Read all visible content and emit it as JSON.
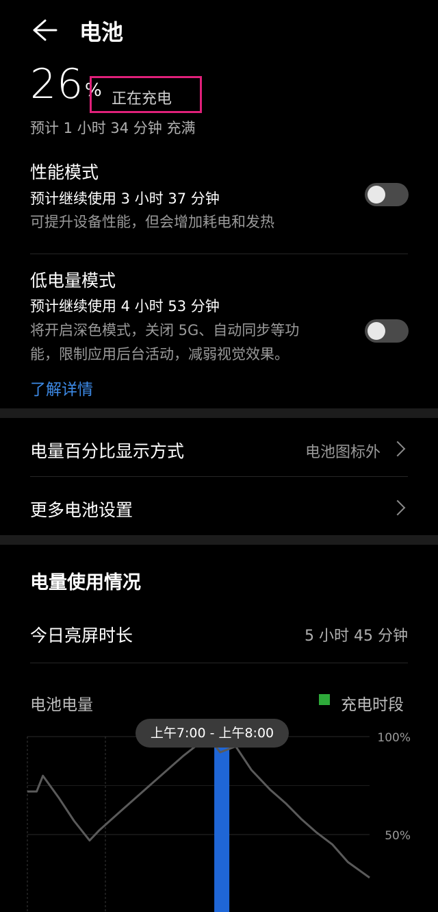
{
  "header": {
    "title": "电池",
    "back_icon": "arrow-left-icon"
  },
  "battery": {
    "level": "26",
    "unit": "%",
    "status": "正在充电",
    "estimate": "预计 1 小时 34 分钟 充满"
  },
  "performance_mode": {
    "title": "性能模式",
    "estimate": "预计继续使用 3 小时 37 分钟",
    "description": "可提升设备性能，但会增加耗电和发热",
    "enabled": false
  },
  "low_power_mode": {
    "title": "低电量模式",
    "estimate": "预计继续使用 4 小时 53 分钟",
    "description_line1": "将开启深色模式，关闭 5G、自动同步等功",
    "description_line2": "能，限制应用后台活动，减弱视觉效果。",
    "enabled": false,
    "learn_more": "了解详情"
  },
  "settings": {
    "percentage_display": {
      "label": "电量百分比显示方式",
      "value": "电池图标外"
    },
    "more_settings": {
      "label": "更多电池设置"
    }
  },
  "usage": {
    "section_title": "电量使用情况",
    "screen_time_label": "今日亮屏时长",
    "screen_time_value": "5 小时 45 分钟"
  },
  "chart_data": {
    "type": "line",
    "title": "电池电量",
    "legend": [
      "充电时段"
    ],
    "legend_color": "#2eaa3a",
    "tooltip": "上午7:00 - 上午8:00",
    "y_ticks": [
      "100%",
      "50%"
    ],
    "ylim": [
      0,
      100
    ],
    "line_color": "#5a5a5a",
    "charge_color": "#1f66d6",
    "series": [
      {
        "values": [
          [
            0,
            72
          ],
          [
            0.3,
            72
          ],
          [
            0.5,
            80
          ],
          [
            1.0,
            69
          ],
          [
            1.5,
            57
          ],
          [
            2.0,
            47
          ],
          [
            2.3,
            52
          ],
          [
            3.0,
            62
          ],
          [
            4.0,
            76
          ],
          [
            5.0,
            90
          ],
          [
            5.8,
            100
          ],
          [
            6.2,
            92
          ],
          [
            6.7,
            95
          ],
          [
            7.2,
            83
          ],
          [
            7.8,
            73
          ],
          [
            8.3,
            66
          ],
          [
            8.8,
            58
          ],
          [
            9.3,
            51
          ],
          [
            9.8,
            45
          ],
          [
            10.3,
            36
          ],
          [
            11.0,
            28
          ]
        ]
      }
    ],
    "charging_segment": [
      5.7,
      6.3
    ]
  }
}
